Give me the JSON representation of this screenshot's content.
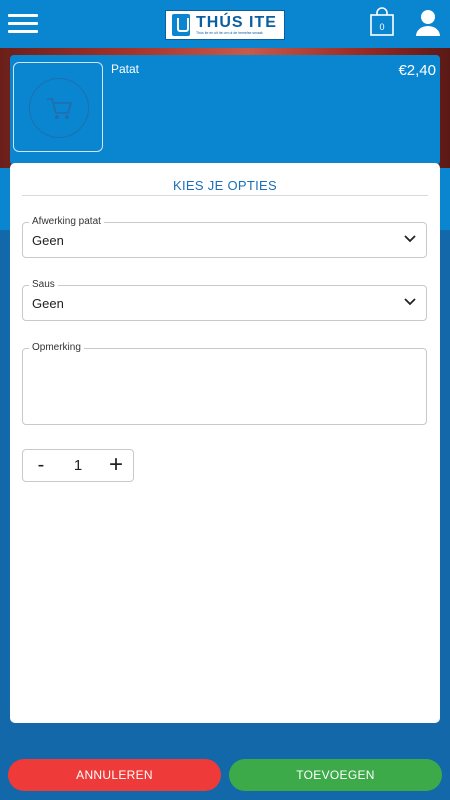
{
  "header": {
    "logo_name": "THÚS ITE",
    "logo_tagline": "Thús ite en uit ite om ut de hemelse smaak",
    "cart_count": "0"
  },
  "product": {
    "name": "Patat",
    "price": "€2,40"
  },
  "options": {
    "title": "KIES JE OPTIES",
    "finish": {
      "label": "Afwerking patat",
      "value": "Geen"
    },
    "sauce": {
      "label": "Saus",
      "value": "Geen"
    },
    "remark": {
      "label": "Opmerking",
      "value": ""
    },
    "quantity": {
      "minus": "-",
      "value": "1",
      "plus": "+"
    }
  },
  "footer": {
    "cancel_label": "ANNULEREN",
    "add_label": "TOEVOEGEN"
  },
  "colors": {
    "brand_blue": "#0a86d0",
    "cancel_red": "#ef3a3a",
    "add_green": "#3daa4a"
  }
}
